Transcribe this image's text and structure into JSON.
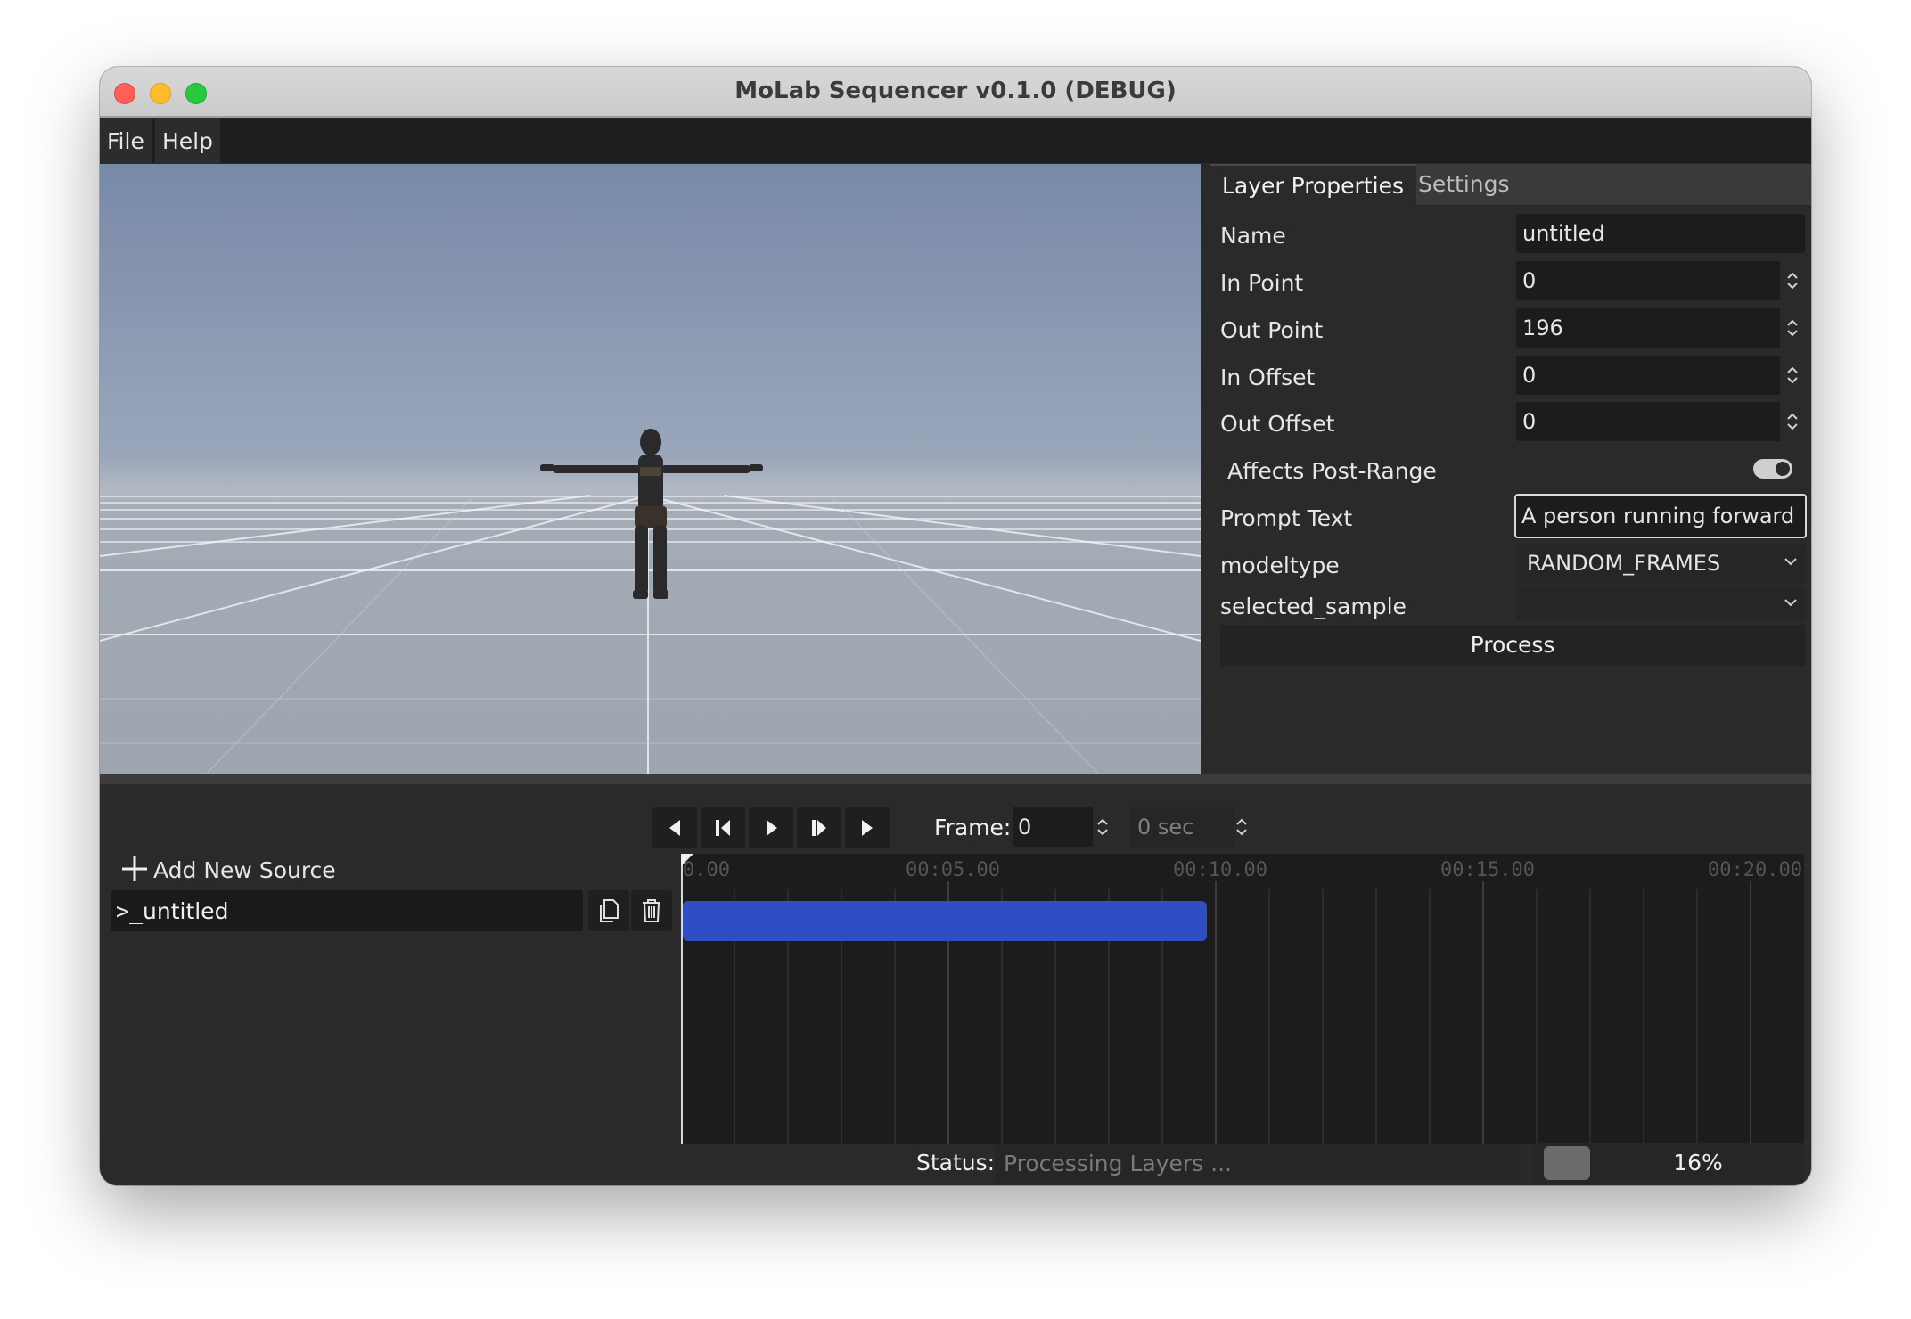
{
  "window": {
    "title": "MoLab Sequencer v0.1.0 (DEBUG)"
  },
  "menu": {
    "file": "File",
    "help": "Help"
  },
  "right_panel": {
    "tabs": [
      {
        "label": "Layer Properties",
        "active": true
      },
      {
        "label": "Settings",
        "active": false
      }
    ],
    "properties": {
      "name": {
        "label": "Name",
        "value": "untitled"
      },
      "in_point": {
        "label": "In Point",
        "value": "0"
      },
      "out_point": {
        "label": "Out Point",
        "value": "196"
      },
      "in_offset": {
        "label": "In Offset",
        "value": "0"
      },
      "out_offset": {
        "label": "Out Offset",
        "value": "0"
      },
      "affects_post_range": {
        "label": "Affects Post-Range",
        "checked": true
      },
      "prompt_text": {
        "label": "Prompt Text",
        "value": "A person running forward"
      },
      "modeltype": {
        "label": "modeltype",
        "value": "RANDOM_FRAMES"
      },
      "selected_sample": {
        "label": "selected_sample",
        "value": ""
      }
    },
    "process_label": "Process"
  },
  "transport": {
    "frame_label": "Frame:",
    "frame_value": "0",
    "seconds_value": "0 sec"
  },
  "sources": {
    "add_label": "Add New Source",
    "layers": [
      {
        "name": "untitled"
      }
    ]
  },
  "timeline": {
    "tick_labels": [
      "0.00",
      "00:05.00",
      "00:10.00",
      "00:15.00",
      "00:20.00"
    ]
  },
  "status": {
    "label": "Status:",
    "text": "Processing Layers ...",
    "progress_percent": 16,
    "progress_text": "16%"
  },
  "colors": {
    "layer_bar": "#2f4ec4",
    "accent_close": "#ff5f57",
    "accent_min": "#febc2e",
    "accent_max": "#28c840"
  }
}
